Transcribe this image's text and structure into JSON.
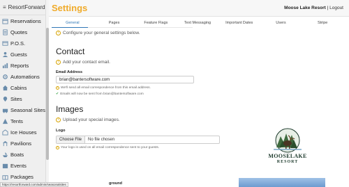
{
  "app": {
    "name": "ResortForward"
  },
  "sidebar": {
    "items": [
      {
        "label": "Reservations",
        "icon": "calendar-icon"
      },
      {
        "label": "Quotes",
        "icon": "quote-icon"
      },
      {
        "label": "P.O.S.",
        "icon": "pos-icon"
      },
      {
        "label": "Guests",
        "icon": "guests-icon"
      },
      {
        "label": "Reports",
        "icon": "reports-icon"
      },
      {
        "label": "Automations",
        "icon": "automation-icon"
      },
      {
        "label": "Cabins",
        "icon": "cabin-icon"
      },
      {
        "label": "Sites",
        "icon": "sites-icon"
      },
      {
        "label": "Seasonal Sites",
        "icon": "seasonal-icon"
      },
      {
        "label": "Tents",
        "icon": "tent-icon"
      },
      {
        "label": "Ice Houses",
        "icon": "ice-house-icon"
      },
      {
        "label": "Pavilions",
        "icon": "pavilion-icon"
      },
      {
        "label": "Boats",
        "icon": "boat-icon"
      },
      {
        "label": "Events",
        "icon": "events-icon"
      },
      {
        "label": "Packages",
        "icon": "packages-icon"
      }
    ]
  },
  "header": {
    "title": "Settings",
    "resort_name": "Moose Lake Resort",
    "separator": "|",
    "logout": "Logout"
  },
  "tabs": [
    "General",
    "Pages",
    "Feature Flags",
    "Text Messaging",
    "Important Dates",
    "Users",
    "Stripe"
  ],
  "general": {
    "intro": "Configure your general settings below.",
    "contact": {
      "heading": "Contact",
      "hint": "Add your contact email.",
      "email_label": "Email Address",
      "email_value": "brian@bantersoftware.com",
      "note1": "We'll send all email correspondence from this email address.",
      "note2": "Emails will now be sent from brian@bantersoftware.com"
    },
    "images": {
      "heading": "Images",
      "hint": "Upload your special images.",
      "logo_label": "Logo",
      "choose_file": "Choose File",
      "no_file": "No file chosen",
      "logo_note": "Your logo is used on all email correspondence sent to your guests.",
      "logo_text_line1": "MOOSELAKE",
      "logo_text_line2": "RESORT",
      "partial_label": "ground"
    }
  },
  "status_bar": {
    "url": "https://resortforward.com/admin/seasonalsites"
  },
  "colors": {
    "accent": "#f0ab2a",
    "tab_active": "#2f77b6",
    "logo_green": "#1d3a2c"
  }
}
